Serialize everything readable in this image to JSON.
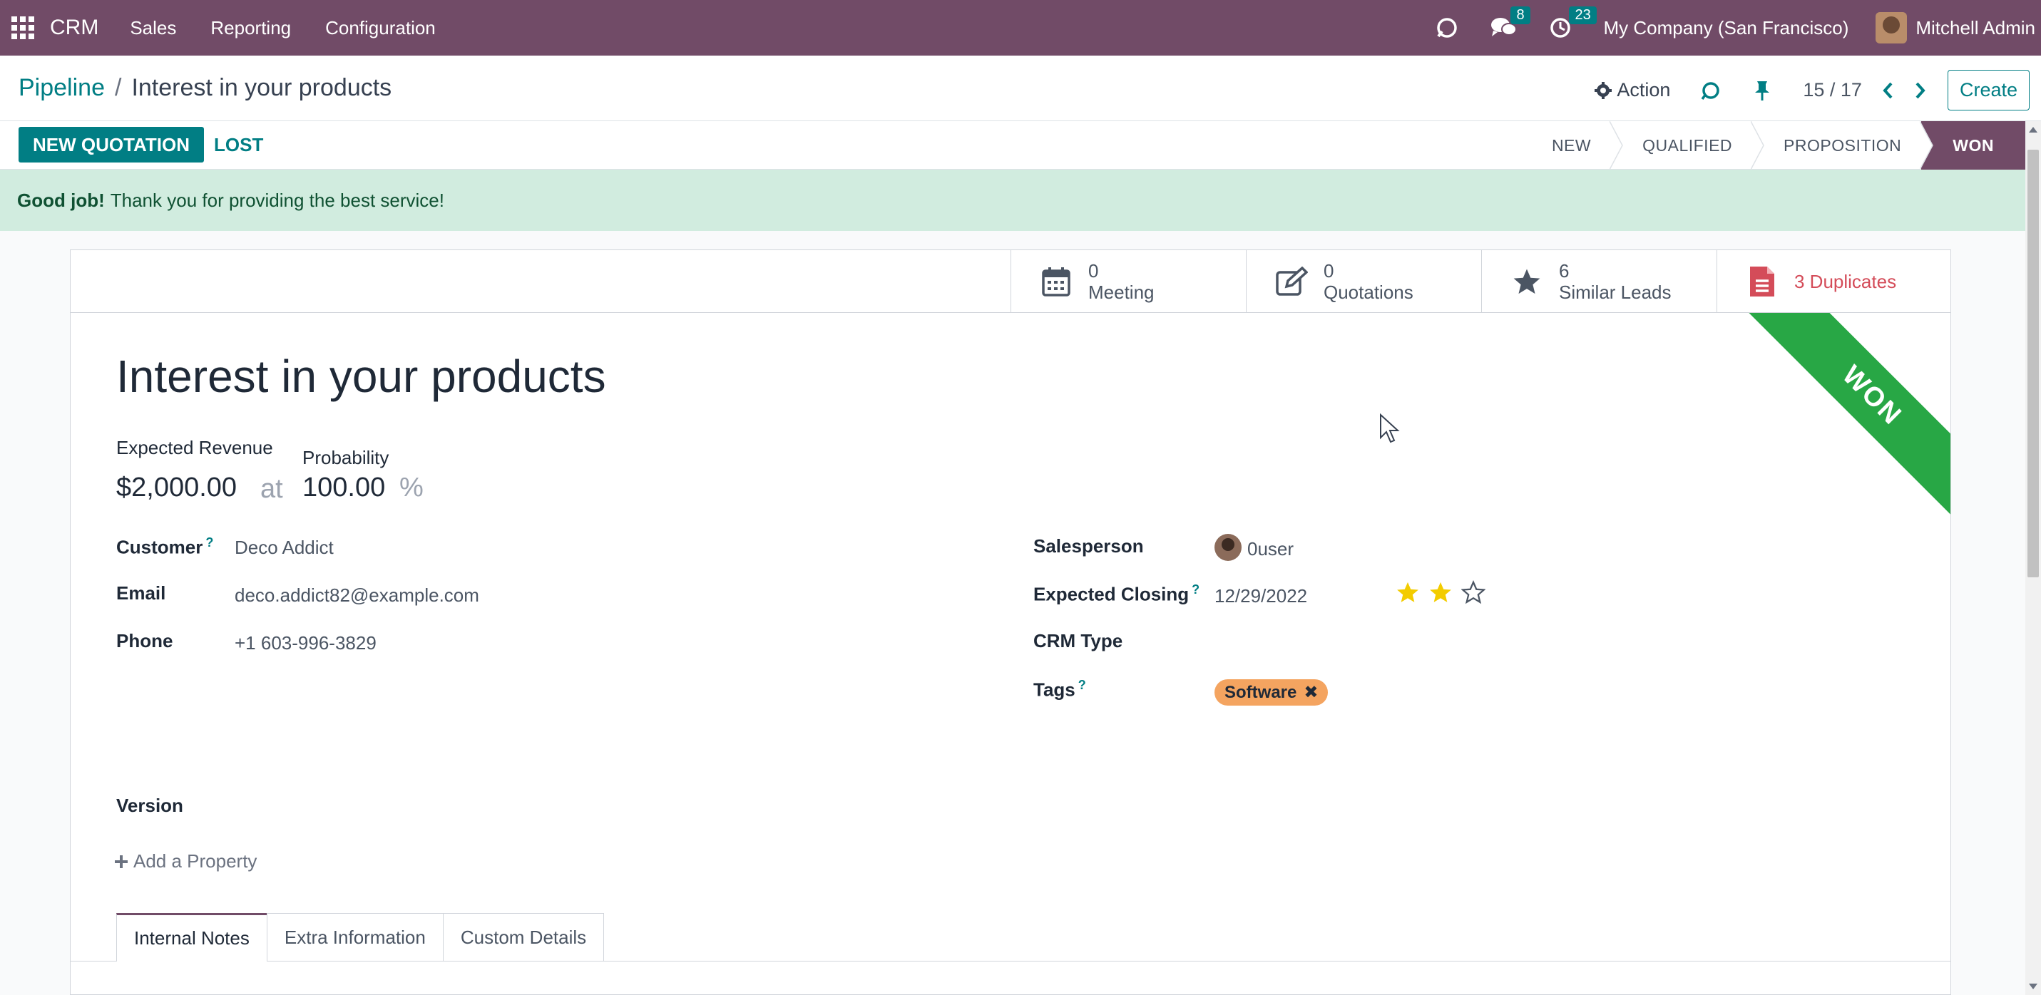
{
  "navbar": {
    "app_name": "CRM",
    "menus": [
      "Sales",
      "Reporting",
      "Configuration"
    ],
    "messages_count": "8",
    "activities_count": "23",
    "company": "My Company (San Francisco)",
    "user": "Mitchell Admin"
  },
  "control": {
    "breadcrumb_parent": "Pipeline",
    "breadcrumb_current": "Interest in your products",
    "action_label": "Action",
    "pager": "15 / 17",
    "create_label": "Create"
  },
  "statusbar": {
    "new_quotation": "NEW QUOTATION",
    "lost": "LOST",
    "stages": [
      "NEW",
      "QUALIFIED",
      "PROPOSITION",
      "WON"
    ],
    "active_stage": "WON"
  },
  "alert": {
    "bold": "Good job!",
    "text": "Thank you for providing the best service!"
  },
  "smart_buttons": {
    "meeting_count": "0",
    "meeting_label": "Meeting",
    "quotations_count": "0",
    "quotations_label": "Quotations",
    "similar_count": "6",
    "similar_label": "Similar Leads",
    "duplicates_label": "3 Duplicates"
  },
  "ribbon": "WON",
  "form": {
    "title": "Interest in your products",
    "expected_revenue_label": "Expected Revenue",
    "probability_label": "Probability",
    "revenue": "$2,000.00",
    "at": "at",
    "probability": "100.00",
    "percent": "%",
    "customer_label": "Customer",
    "customer": "Deco Addict",
    "email_label": "Email",
    "email": "deco.addict82@example.com",
    "phone_label": "Phone",
    "phone": "+1 603-996-3829",
    "salesperson_label": "Salesperson",
    "salesperson": "0user",
    "expected_closing_label": "Expected Closing",
    "expected_closing": "12/29/2022",
    "priority_stars": 2,
    "priority_max": 3,
    "crm_type_label": "CRM Type",
    "tags_label": "Tags",
    "tag": "Software",
    "version_label": "Version",
    "add_property": "Add a Property",
    "help_mark": "?"
  },
  "tabs": [
    "Internal Notes",
    "Extra Information",
    "Custom Details"
  ],
  "colors": {
    "brand": "#714b67",
    "accent": "#017e84",
    "success": "#28a745",
    "danger": "#d44c59",
    "tag": "#f4a460",
    "star": "#f3cc00"
  }
}
